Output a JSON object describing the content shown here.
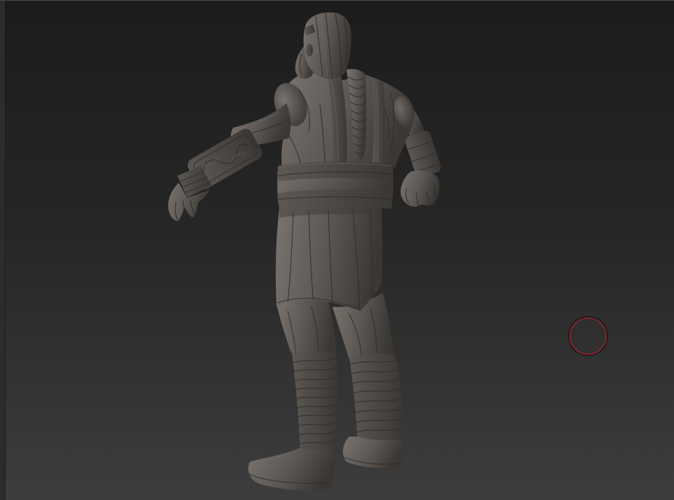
{
  "viewport": {
    "background_top": "#1c1c1c",
    "background_bottom": "#3d3d3d",
    "frame_edge": "#2c2c2c"
  },
  "model": {
    "highlight": "#7a746f",
    "base": "#5d5854",
    "shadow": "#3b3734",
    "detail_line": "#2f2c2a"
  },
  "brush_cursor": {
    "icon": "brush-cursor-icon",
    "ring_color": "#b0222a",
    "inner_ring_color": "#333333"
  }
}
